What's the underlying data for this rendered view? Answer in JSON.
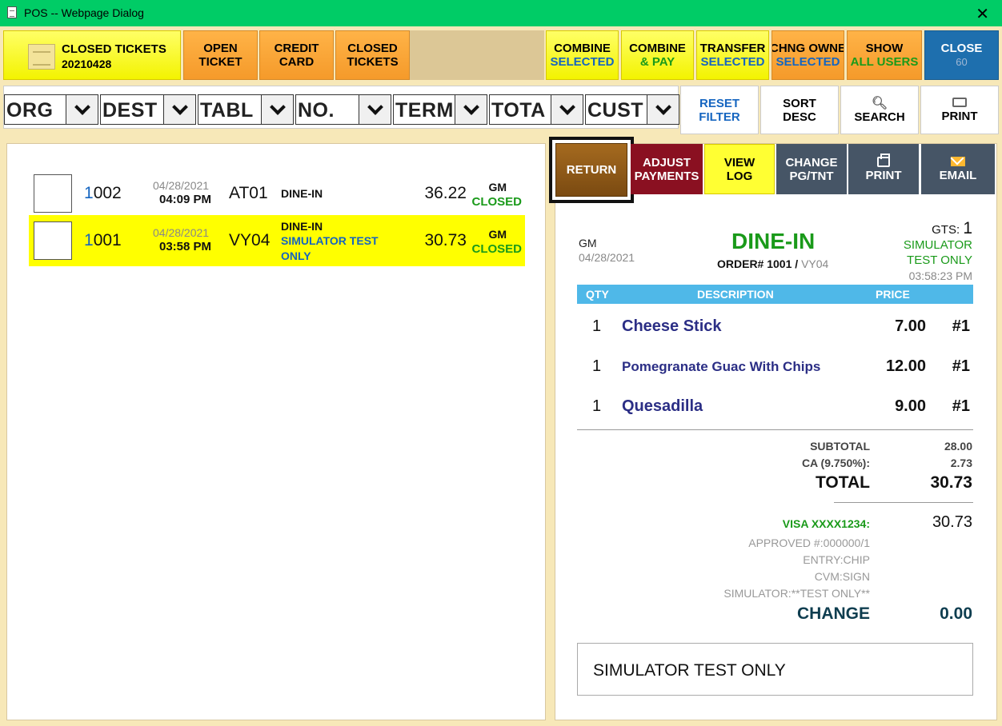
{
  "window": {
    "title": "POS -- Webpage Dialog"
  },
  "toolbar": {
    "header": {
      "title": "CLOSED TICKETS",
      "date": "20210428"
    },
    "open_ticket": [
      "OPEN",
      "TICKET"
    ],
    "credit_card": [
      "CREDIT",
      "CARD"
    ],
    "closed_tickets": [
      "CLOSED",
      "TICKETS"
    ],
    "combine_selected": [
      "COMBINE",
      "SELECTED"
    ],
    "combine_pay": [
      "COMBINE",
      "& PAY"
    ],
    "transfer_selected": [
      "TRANSFER",
      "SELECTED"
    ],
    "chng_owner": [
      "CHNG OWNE",
      "SELECTED"
    ],
    "show_all": [
      "SHOW",
      "ALL USERS"
    ],
    "close": [
      "CLOSE",
      "60"
    ]
  },
  "filters": [
    "ORG",
    "DEST",
    "TABL",
    "NO.",
    "TERM",
    "TOTA",
    "CUST"
  ],
  "utility": {
    "reset_filter": [
      "RESET",
      "FILTER"
    ],
    "sort_desc": [
      "SORT",
      "DESC"
    ],
    "search": "SEARCH",
    "print": "PRINT"
  },
  "tickets": [
    {
      "num_first": "1",
      "num_rest": "002",
      "date": "04/28/2021",
      "time": "04:09 PM",
      "table": "AT01",
      "type": "DINE-IN",
      "note": "",
      "amount": "36.22",
      "server": "GM",
      "status": "CLOSED"
    },
    {
      "num_first": "1",
      "num_rest": "001",
      "date": "04/28/2021",
      "time": "03:58 PM",
      "table": "VY04",
      "type": "DINE-IN",
      "note_line1": "SIMULATOR TEST",
      "note_line2": "ONLY",
      "amount": "30.73",
      "server": "GM",
      "status": "CLOSED"
    }
  ],
  "actions": {
    "return": "RETURN",
    "adjust": [
      "ADJUST",
      "PAYMENTS"
    ],
    "view_log": [
      "VIEW",
      "LOG"
    ],
    "change": [
      "CHANGE",
      "PG/TNT"
    ],
    "print": "PRINT",
    "email": "EMAIL"
  },
  "receipt": {
    "server": "GM",
    "date": "04/28/2021",
    "type": "DINE-IN",
    "order_label": "ORDER# 1001",
    "order_table": "VY04",
    "gts_label": "GTS:",
    "gts_value": "1",
    "customer_line1": "SIMULATOR",
    "customer_line2": "TEST ONLY",
    "time": "03:58:23 PM",
    "head": {
      "qty": "QTY",
      "desc": "DESCRIPTION",
      "price": "PRICE"
    },
    "items": [
      {
        "qty": "1",
        "desc": "Cheese Stick",
        "price": "7.00",
        "seat": "#1"
      },
      {
        "qty": "1",
        "desc": "Pomegranate Guac With Chips",
        "price": "12.00",
        "seat": "#1"
      },
      {
        "qty": "1",
        "desc": "Quesadilla",
        "price": "9.00",
        "seat": "#1"
      }
    ],
    "subtotal_label": "SUBTOTAL",
    "subtotal": "28.00",
    "tax_label": "CA (9.750%):",
    "tax": "2.73",
    "total_label": "TOTAL",
    "total": "30.73",
    "payment_label": "VISA XXXX1234:",
    "payment": "30.73",
    "approved": "APPROVED #:000000/1",
    "entry": "ENTRY:CHIP",
    "cvm": "CVM:SIGN",
    "simulator": "SIMULATOR:**TEST ONLY**",
    "change_label": "CHANGE",
    "change": "0.00",
    "note": "SIMULATOR TEST ONLY"
  }
}
